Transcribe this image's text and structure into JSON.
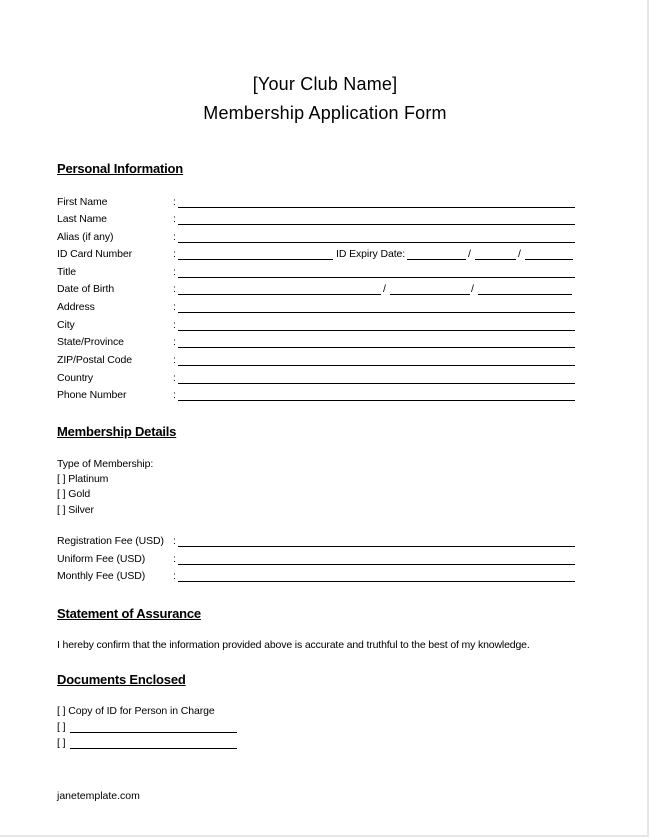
{
  "header": {
    "club_name": "[Your Club Name]",
    "form_title": "Membership Application  Form"
  },
  "personal_information": {
    "heading": "Personal Information",
    "separator": ":",
    "fields": [
      {
        "label": "First Name",
        "value": ""
      },
      {
        "label": "Last Name",
        "value": ""
      },
      {
        "label": "Alias (if any)",
        "value": ""
      },
      {
        "label": "ID Card Number",
        "value": "",
        "expiry_label": "ID Expiry Date:",
        "expiry_value": [
          "",
          "",
          ""
        ]
      },
      {
        "label": "Title",
        "value": ""
      },
      {
        "label": "Date of Birth",
        "value": [
          "",
          "",
          ""
        ]
      },
      {
        "label": "Address",
        "value": ""
      },
      {
        "label": "City",
        "value": ""
      },
      {
        "label": "State/Province",
        "value": ""
      },
      {
        "label": "ZIP/Postal Code",
        "value": ""
      },
      {
        "label": "Country",
        "value": ""
      },
      {
        "label": "Phone Number",
        "value": ""
      }
    ],
    "date_separator": "/"
  },
  "membership_details": {
    "heading": "Membership Details",
    "type_label": "Type of Membership:",
    "options": [
      {
        "box": "[ ]",
        "label": "Platinum",
        "checked": false
      },
      {
        "box": "[ ]",
        "label": "Gold",
        "checked": false
      },
      {
        "box": "[ ]",
        "label": "Silver",
        "checked": false
      }
    ],
    "fees": [
      {
        "label": "Registration Fee (USD)",
        "value": ""
      },
      {
        "label": "Uniform Fee (USD)",
        "value": ""
      },
      {
        "label": "Monthly Fee (USD)",
        "value": ""
      }
    ]
  },
  "statement": {
    "heading": "Statement of Assurance",
    "text": "I hereby confirm that the information provided above is accurate and truthful to the best of my knowledge."
  },
  "documents": {
    "heading": "Documents Enclosed",
    "items": [
      {
        "box": "[ ]",
        "label": "Copy of ID for Person in Charge"
      },
      {
        "box": "[ ]",
        "label": ""
      },
      {
        "box": "[ ]",
        "label": ""
      }
    ]
  },
  "footer": {
    "source": "janetemplate.com"
  }
}
